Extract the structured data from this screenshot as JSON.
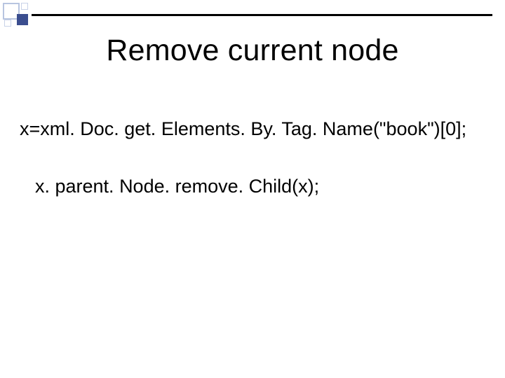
{
  "title": "Remove current node",
  "body": {
    "line1": "x=xml. Doc. get. Elements. By. Tag. Name(\"book\")[0];",
    "line2": "x. parent. Node. remove. Child(x);"
  }
}
